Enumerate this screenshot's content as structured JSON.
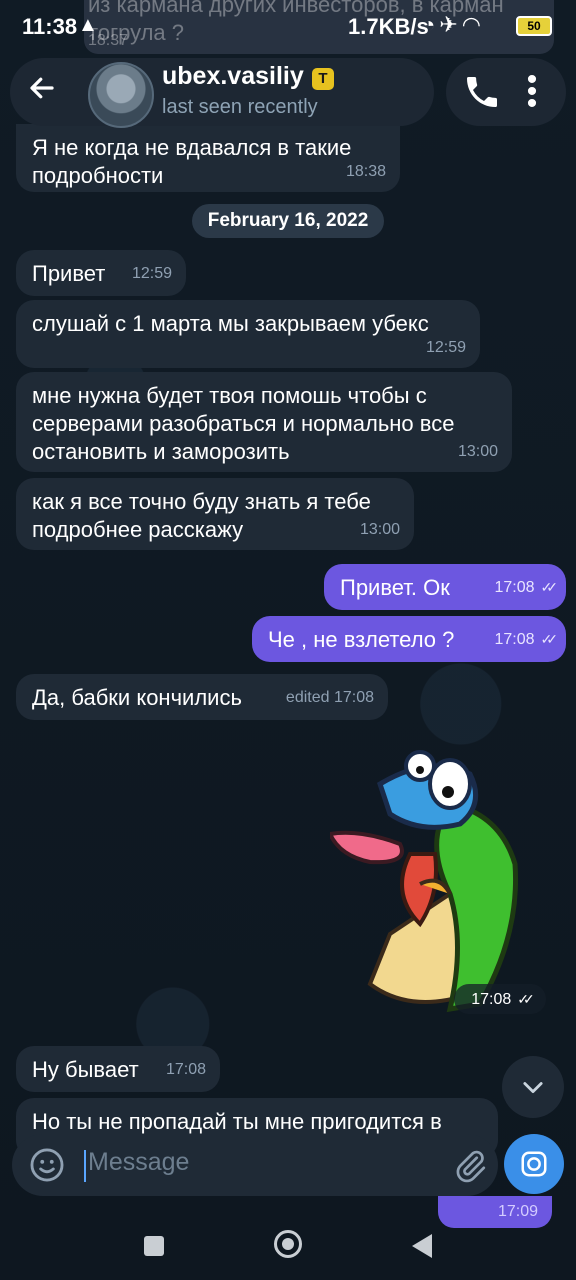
{
  "status_bar": {
    "time": "11:38",
    "warning_icon": "warning-triangle-icon",
    "net_speed": "1.7KB/s",
    "battery": "50"
  },
  "notification_peek": {
    "line1": "из кармана других инвесторов, в карман",
    "line2": "тогрула ?",
    "time": "18:37"
  },
  "header": {
    "title": "ubex.vasiliy",
    "badge": "T",
    "subtitle": "last seen recently"
  },
  "date_divider": "February 16, 2022",
  "messages": [
    {
      "text": "Я не когда не вдавался в такие подробности",
      "time": "18:38",
      "dir": "in"
    },
    {
      "text": "Привет",
      "time": "12:59",
      "dir": "in"
    },
    {
      "text": "слушай с 1 марта мы закрываем убекс",
      "time": "12:59",
      "dir": "in"
    },
    {
      "text": "мне нужна будет твоя помошь чтобы с серверами разобраться и нормально все остановить и заморозить",
      "time": "13:00",
      "dir": "in"
    },
    {
      "text": "как я все точно буду знать я тебе подробнее расскажу",
      "time": "13:00",
      "dir": "in"
    },
    {
      "text": "Привет. Ок",
      "time": "17:08",
      "dir": "out"
    },
    {
      "text": "Че , не взлетело ?",
      "time": "17:08",
      "dir": "out"
    },
    {
      "text": "Да, бабки кончились",
      "time": "edited 17:08",
      "dir": "in"
    },
    {
      "text": "Ну бывает",
      "time": "17:08",
      "dir": "in"
    },
    {
      "text": "Но ты не пропадай ты мне пригодится в",
      "time": "",
      "dir": "in"
    }
  ],
  "sticker": {
    "time": "17:08"
  },
  "under_input_time": "17:09",
  "input": {
    "placeholder": "Message"
  }
}
